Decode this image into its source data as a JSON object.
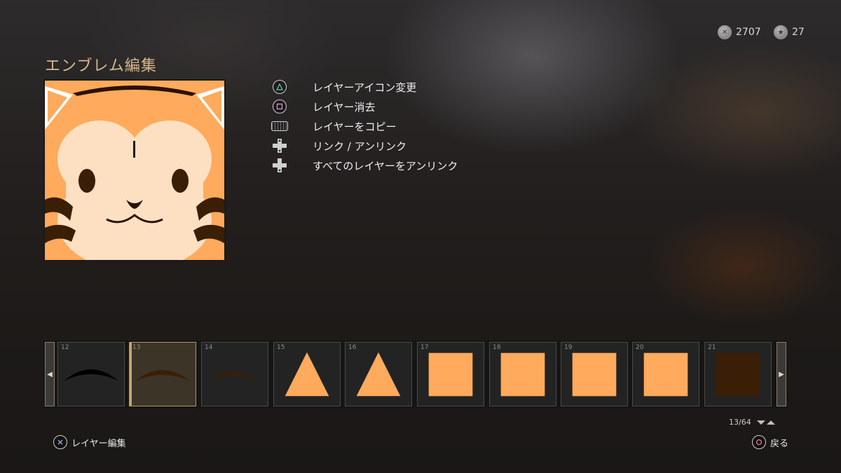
{
  "header": {
    "title": "エンブレム編集",
    "currency_a": {
      "icon": "cod-points-icon",
      "value": "2707"
    },
    "currency_b": {
      "icon": "credits-icon",
      "value": "27"
    }
  },
  "actions": [
    {
      "button": "triangle-button",
      "label": "レイヤーアイコン変更"
    },
    {
      "button": "square-button",
      "label": "レイヤー消去"
    },
    {
      "button": "touchpad-button",
      "label": "レイヤーをコピー"
    },
    {
      "button": "dpad-up-down",
      "label": "リンク / アンリンク"
    },
    {
      "button": "dpad-down",
      "label": "すべてのレイヤーをアンリンク"
    }
  ],
  "layers": [
    {
      "number": "12",
      "shape": "arc",
      "color": "#000000"
    },
    {
      "number": "13",
      "shape": "arc",
      "color": "#3a1e05",
      "selected": true
    },
    {
      "number": "14",
      "shape": "arc",
      "color": "#3a1e05"
    },
    {
      "number": "15",
      "shape": "triangle",
      "color": "#ffaa5c"
    },
    {
      "number": "16",
      "shape": "triangle",
      "color": "#ffaa5c"
    },
    {
      "number": "17",
      "shape": "square",
      "color": "#ffaa5c"
    },
    {
      "number": "18",
      "shape": "square",
      "color": "#ffaa5c"
    },
    {
      "number": "19",
      "shape": "square",
      "color": "#ffaa5c"
    },
    {
      "number": "20",
      "shape": "square",
      "color": "#ffaa5c"
    },
    {
      "number": "21",
      "shape": "square",
      "color": "#3a1e05"
    }
  ],
  "pager": {
    "text": "13/64"
  },
  "footer": {
    "edit_label": "レイヤー編集",
    "back_label": "戻る"
  },
  "colors": {
    "accent": "#d6b78d",
    "emblem_orange": "#ffaa5c",
    "emblem_cream": "#fde0c2",
    "emblem_brown": "#3a1e05"
  }
}
